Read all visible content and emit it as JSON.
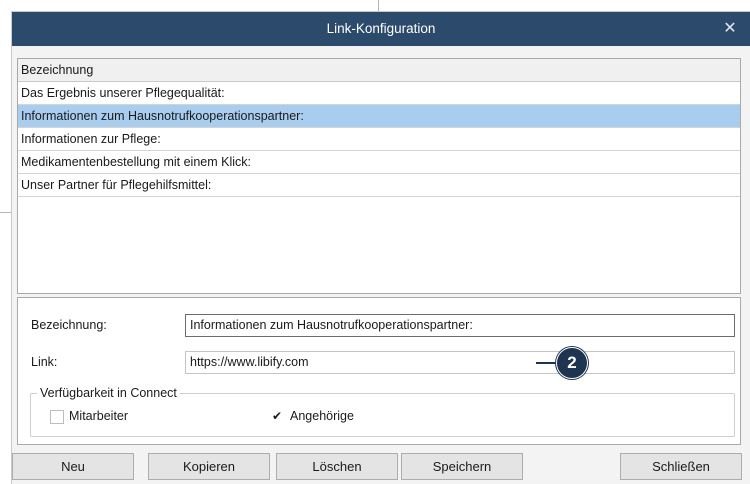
{
  "dialog": {
    "title": "Link-Konfiguration",
    "close_glyph": "✕"
  },
  "list": {
    "header": "Bezeichnung",
    "rows": [
      "Das Ergebnis unserer Pflegequalität:",
      "Informationen zum Hausnotrufkooperationspartner:",
      "Informationen zur Pflege:",
      "Medikamentenbestellung mit einem Klick:",
      "Unser Partner für Pflegehilfsmittel:"
    ],
    "selected_index": 1
  },
  "form": {
    "name_label": "Bezeichnung:",
    "name_value": "Informationen zum Hausnotrufkooperationspartner:",
    "link_label": "Link:",
    "link_value": "https://www.libify.com",
    "group_title": "Verfügbarkeit in Connect",
    "option1": {
      "label": "Mitarbeiter",
      "checked": false
    },
    "option2": {
      "label": "Angehörige",
      "checked": true,
      "check_glyph": "✔"
    }
  },
  "callout": {
    "number": "2"
  },
  "buttons": {
    "new": "Neu",
    "copy": "Kopieren",
    "delete": "Löschen",
    "save": "Speichern",
    "close": "Schließen"
  },
  "colors": {
    "titlebar": "#2b4a6c",
    "selection": "#a9cdef",
    "callout": "#1e3450"
  }
}
